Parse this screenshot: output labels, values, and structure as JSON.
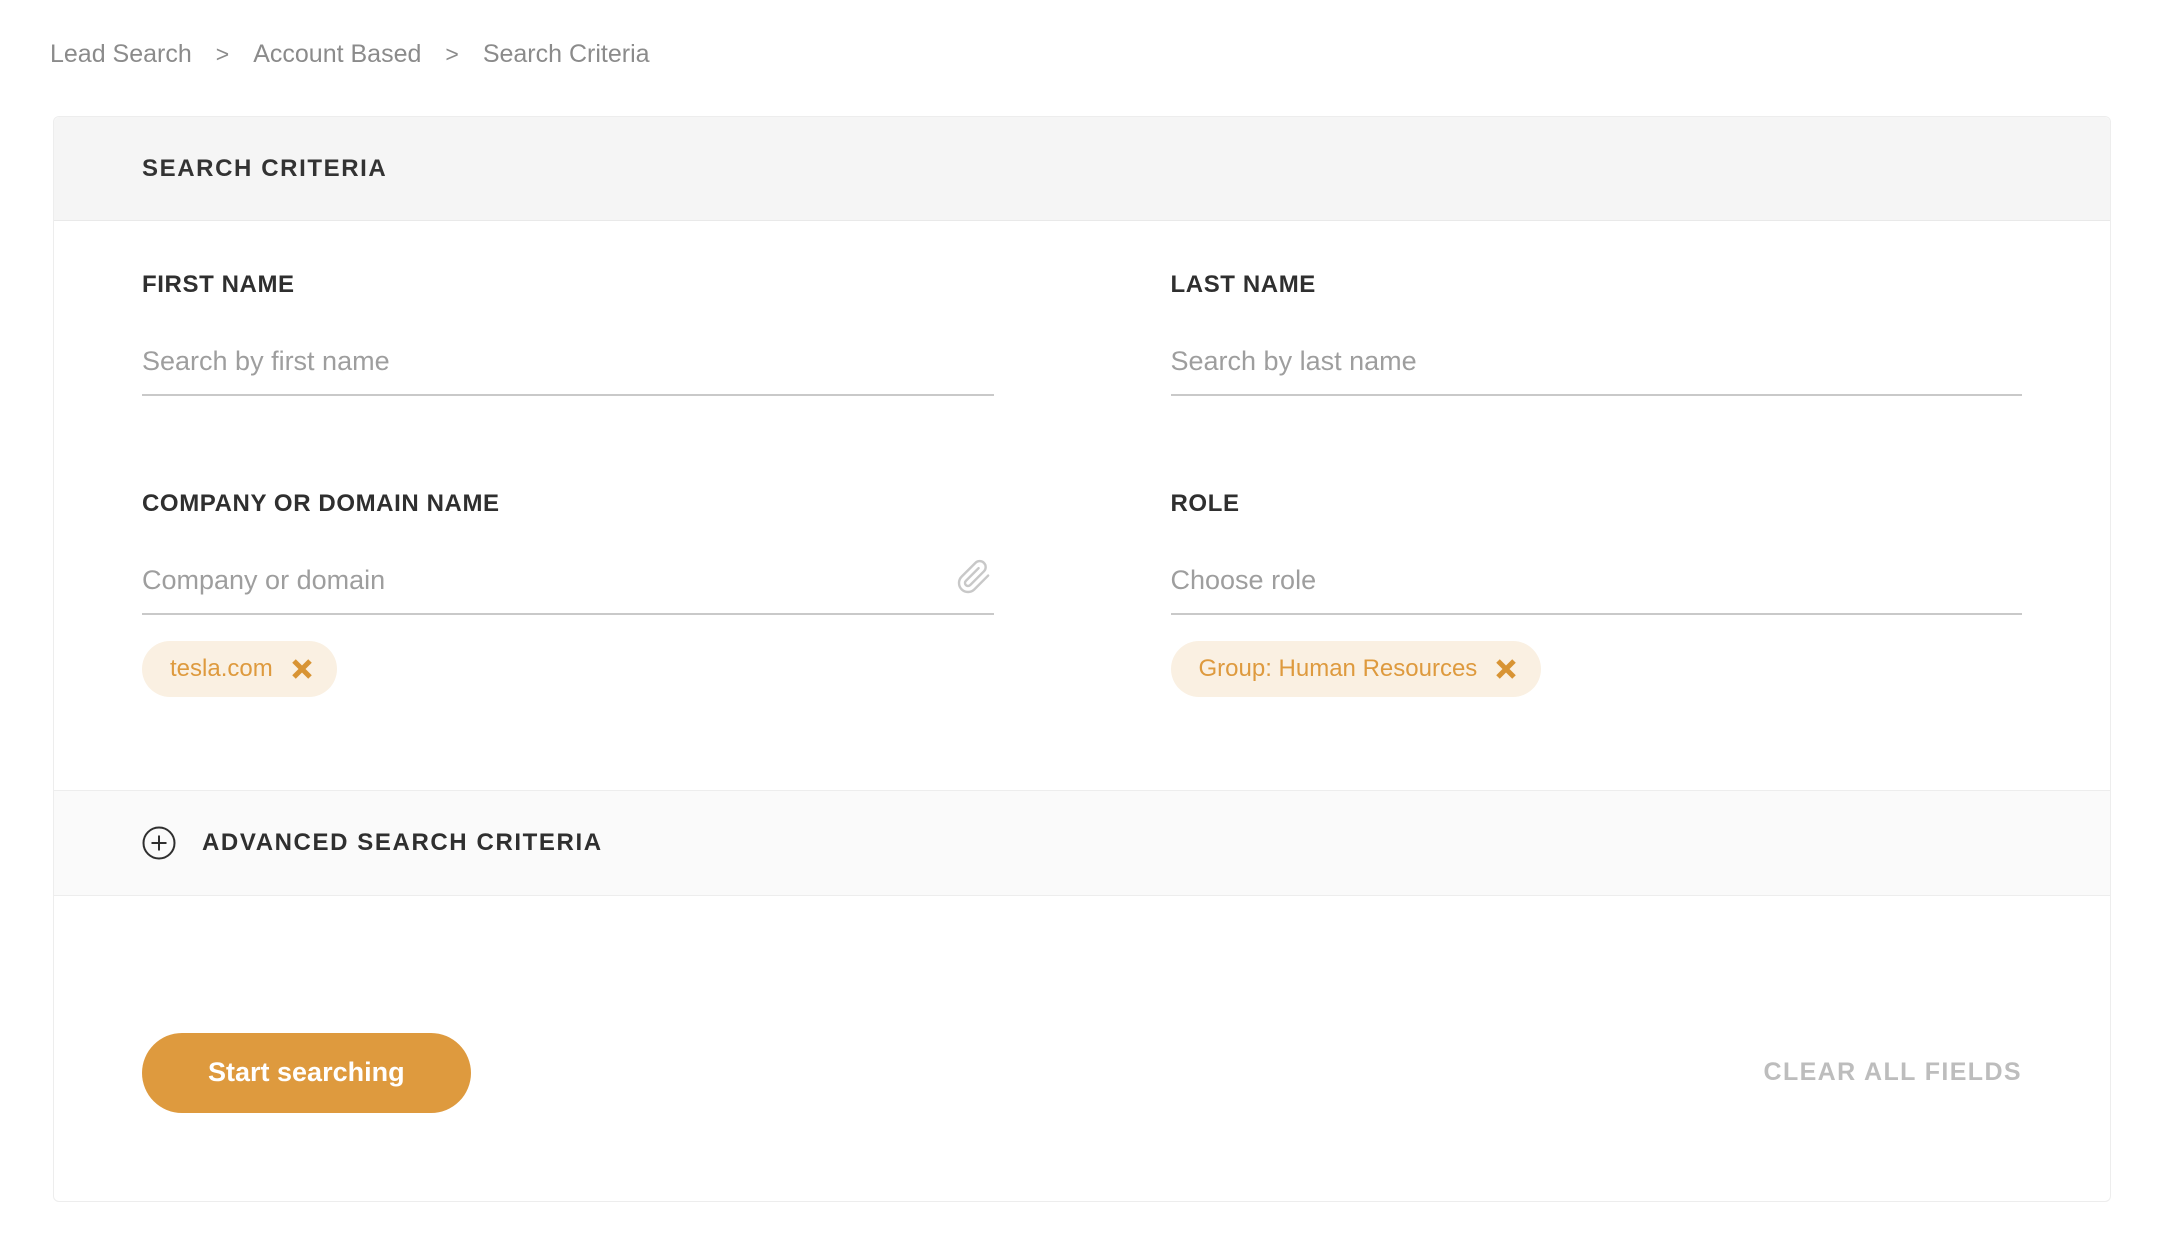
{
  "breadcrumb": {
    "separator": ">",
    "items": [
      {
        "label": "Lead Search"
      },
      {
        "label": "Account Based"
      },
      {
        "label": "Search Criteria"
      }
    ]
  },
  "card": {
    "header_title": "SEARCH CRITERIA",
    "fields": {
      "first_name": {
        "label": "FIRST NAME",
        "placeholder": "Search by first name",
        "value": ""
      },
      "last_name": {
        "label": "LAST NAME",
        "placeholder": "Search by last name",
        "value": ""
      },
      "company": {
        "label": "COMPANY OR DOMAIN NAME",
        "placeholder": "Company or domain",
        "value": "",
        "attachment_icon": "paperclip-icon",
        "tags": [
          {
            "label": "tesla.com",
            "remove_icon": "x-icon"
          }
        ]
      },
      "role": {
        "label": "ROLE",
        "placeholder": "Choose role",
        "value": "",
        "tags": [
          {
            "label": "Group: Human Resources",
            "remove_icon": "x-icon"
          }
        ]
      }
    },
    "advanced": {
      "toggle_icon": "plus-circle-icon",
      "label": "ADVANCED SEARCH CRITERIA"
    },
    "footer": {
      "search_button_label": "Start searching",
      "clear_all_label": "CLEAR ALL FIELDS"
    }
  },
  "colors": {
    "accent_orange": "#de9a3e",
    "tag_background": "#faf0e2",
    "tag_text": "#de9a3e",
    "remove_icon": "#d89434",
    "header_band": "#f5f5f5",
    "advanced_band": "#fafafa"
  }
}
